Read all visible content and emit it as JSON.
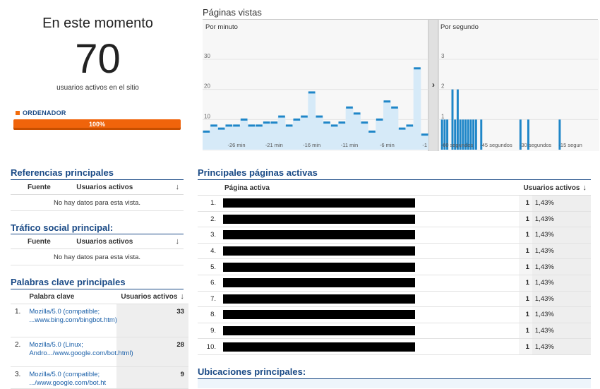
{
  "summary": {
    "title": "En este momento",
    "count": "70",
    "subtitle": "usuarios activos en el sitio",
    "device_label": "ORDENADOR",
    "device_percent_label": "100%",
    "device_fraction": 1.0,
    "device_color": "#f26c0c"
  },
  "chart": {
    "title": "Páginas vistas",
    "left_label": "Por minuto",
    "right_label": "Por segundo",
    "expand_glyph": "›",
    "left_y_ticks": [
      "30",
      "20",
      "10"
    ],
    "right_y_ticks": [
      "3",
      "2",
      "1"
    ],
    "left_x_ticks": [
      "-26 min",
      "-21 min",
      "-16 min",
      "-11 min",
      "-6 min",
      "-1"
    ],
    "right_x_ticks": [
      "-60 segundos",
      "-45 segundos",
      "-30 segundos",
      "-15 segun"
    ]
  },
  "chart_data": [
    {
      "type": "area",
      "title": "Por minuto",
      "ylim": [
        0,
        30
      ],
      "x": [
        -30,
        -29,
        -28,
        -27,
        -26,
        -25,
        -24,
        -23,
        -22,
        -21,
        -20,
        -19,
        -18,
        -17,
        -16,
        -15,
        -14,
        -13,
        -12,
        -11,
        -10,
        -9,
        -8,
        -7,
        -6,
        -5,
        -4,
        -3,
        -2,
        -1
      ],
      "values": [
        6,
        8,
        7,
        8,
        8,
        10,
        8,
        8,
        9,
        9,
        11,
        8,
        10,
        11,
        19,
        11,
        9,
        8,
        9,
        14,
        12,
        9,
        6,
        10,
        16,
        14,
        7,
        8,
        27,
        5
      ],
      "color": "#1f86c8"
    },
    {
      "type": "bar",
      "title": "Por segundo",
      "ylim": [
        0,
        3
      ],
      "x": [
        -60,
        -59,
        -58,
        -56,
        -55,
        -54,
        -53,
        -52,
        -51,
        -50,
        -49,
        -48,
        -47,
        -45,
        -30,
        -27,
        -15
      ],
      "values": [
        1,
        1,
        1,
        2,
        1,
        2,
        1,
        1,
        1,
        1,
        1,
        1,
        1,
        1,
        1,
        1,
        1
      ],
      "color": "#1f86c8"
    }
  ],
  "referrals": {
    "title": "Referencias principales",
    "col_source": "Fuente",
    "col_users": "Usuarios activos",
    "empty": "No hay datos para esta vista."
  },
  "social": {
    "title": "Tráfico social principal:",
    "col_source": "Fuente",
    "col_users": "Usuarios activos",
    "empty": "No hay datos para esta vista."
  },
  "keywords": {
    "title": "Palabras clave principales",
    "col_keyword": "Palabra clave",
    "col_users": "Usuarios activos",
    "rows": [
      {
        "n": "1.",
        "text": "Mozilla/5.0 (compatible; ...www.bing.com/bingbot.htm)",
        "value": "33"
      },
      {
        "n": "2.",
        "text": "Mozilla/5.0 (Linux; Andro.../www.google.com/bot.html)",
        "value": "28"
      },
      {
        "n": "3.",
        "text": "Mozilla/5.0 (compatible; .../www.google.com/bot.ht",
        "value": "9"
      }
    ]
  },
  "pages": {
    "title": "Principales páginas activas",
    "col_page": "Página activa",
    "col_users": "Usuarios activos",
    "rows": [
      {
        "n": "1.",
        "value": "1",
        "pct": "1,43%"
      },
      {
        "n": "2.",
        "value": "1",
        "pct": "1,43%"
      },
      {
        "n": "3.",
        "value": "1",
        "pct": "1,43%"
      },
      {
        "n": "4.",
        "value": "1",
        "pct": "1,43%"
      },
      {
        "n": "5.",
        "value": "1",
        "pct": "1,43%"
      },
      {
        "n": "6.",
        "value": "1",
        "pct": "1,43%"
      },
      {
        "n": "7.",
        "value": "1",
        "pct": "1,43%"
      },
      {
        "n": "8.",
        "value": "1",
        "pct": "1,43%"
      },
      {
        "n": "9.",
        "value": "1",
        "pct": "1,43%"
      },
      {
        "n": "10.",
        "value": "1",
        "pct": "1,43%"
      }
    ]
  },
  "locations": {
    "title": "Ubicaciones principales:"
  },
  "icons": {
    "sort": "sort-descending-icon",
    "expand": "chevron-right-icon"
  }
}
